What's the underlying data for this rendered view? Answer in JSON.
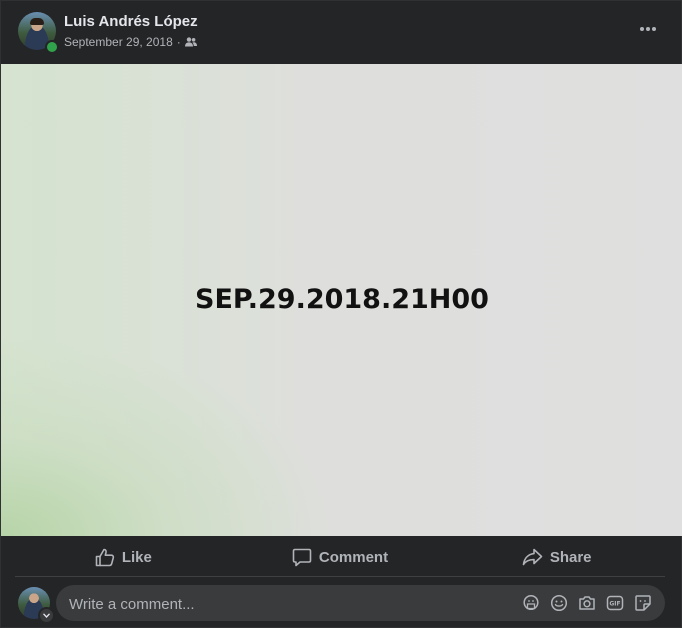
{
  "post": {
    "author": "Luis Andrés López",
    "date": "September 29, 2018",
    "audience_icon": "friends-icon",
    "image_text": "SEP.29.2018.21H00"
  },
  "actions": {
    "like_label": "Like",
    "comment_label": "Comment",
    "share_label": "Share"
  },
  "comment_composer": {
    "placeholder": "Write a comment...",
    "icons": [
      "avatar-sticker-icon",
      "emoji-icon",
      "camera-icon",
      "gif-icon",
      "sticker-icon"
    ]
  },
  "colors": {
    "card_bg": "#242526",
    "primary_text": "#e4e6eb",
    "secondary_text": "#b0b3b8",
    "input_bg": "#3a3b3c",
    "online": "#31a24c"
  }
}
